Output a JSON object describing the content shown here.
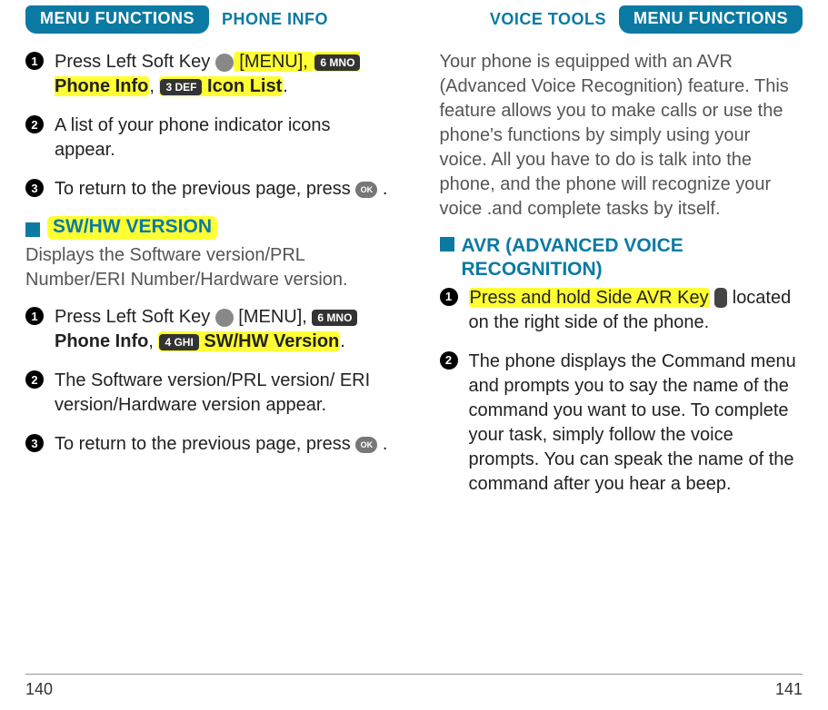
{
  "left": {
    "tab": "MENU FUNCTIONS",
    "subtab": "PHONE INFO",
    "step1_a": "Press Left Soft Key ",
    "step1_b": " [MENU], ",
    "step1_key6": "6 MNO",
    "step1_c": " Phone Info",
    "step1_d": ", ",
    "step1_key3": "3 DEF",
    "step1_e": " Icon List",
    "step1_f": ".",
    "step2": "A list of your phone indicator icons appear.",
    "step3_a": "To return to the previous page, press ",
    "step3_b": " .",
    "ok": "OK",
    "section": "SW/HW VERSION",
    "section_desc": "Displays the Software version/PRL Number/ERI Number/Hardware version.",
    "s2_step1_a": "Press Left Soft Key ",
    "s2_step1_b": " [MENU], ",
    "s2_step1_key6": "6 MNO",
    "s2_step1_c": " Phone Info",
    "s2_step1_d": ", ",
    "s2_step1_key4": "4 GHI",
    "s2_step1_e": " SW/HW Version",
    "s2_step1_f": ".",
    "s2_step2": "The Software version/PRL version/ ERI version/Hardware version appear.",
    "s2_step3_a": "To return to the previous page, press ",
    "s2_step3_b": " .",
    "page": "140"
  },
  "right": {
    "subtab": "VOICE TOOLS",
    "tab": "MENU FUNCTIONS",
    "intro": "Your phone is equipped with an AVR (Advanced Voice Recognition) feature. This feature allows you to make calls or use the phone's functions by simply using your voice. All you have to do is talk into the phone, and the phone will recognize your voice .and complete tasks by itself.",
    "section": "AVR (ADVANCED VOICE RECOGNITION)",
    "step1_a": "Press and hold Side AVR Key",
    "step1_b": " located on the right side of the phone.",
    "step2": "The phone displays the Command menu and prompts you to say the name of the command you want to use. To complete your task, simply follow the voice prompts. You can speak the name of the command after you hear a beep.",
    "page": "141"
  },
  "nums": {
    "n1": "1",
    "n2": "2",
    "n3": "3"
  }
}
